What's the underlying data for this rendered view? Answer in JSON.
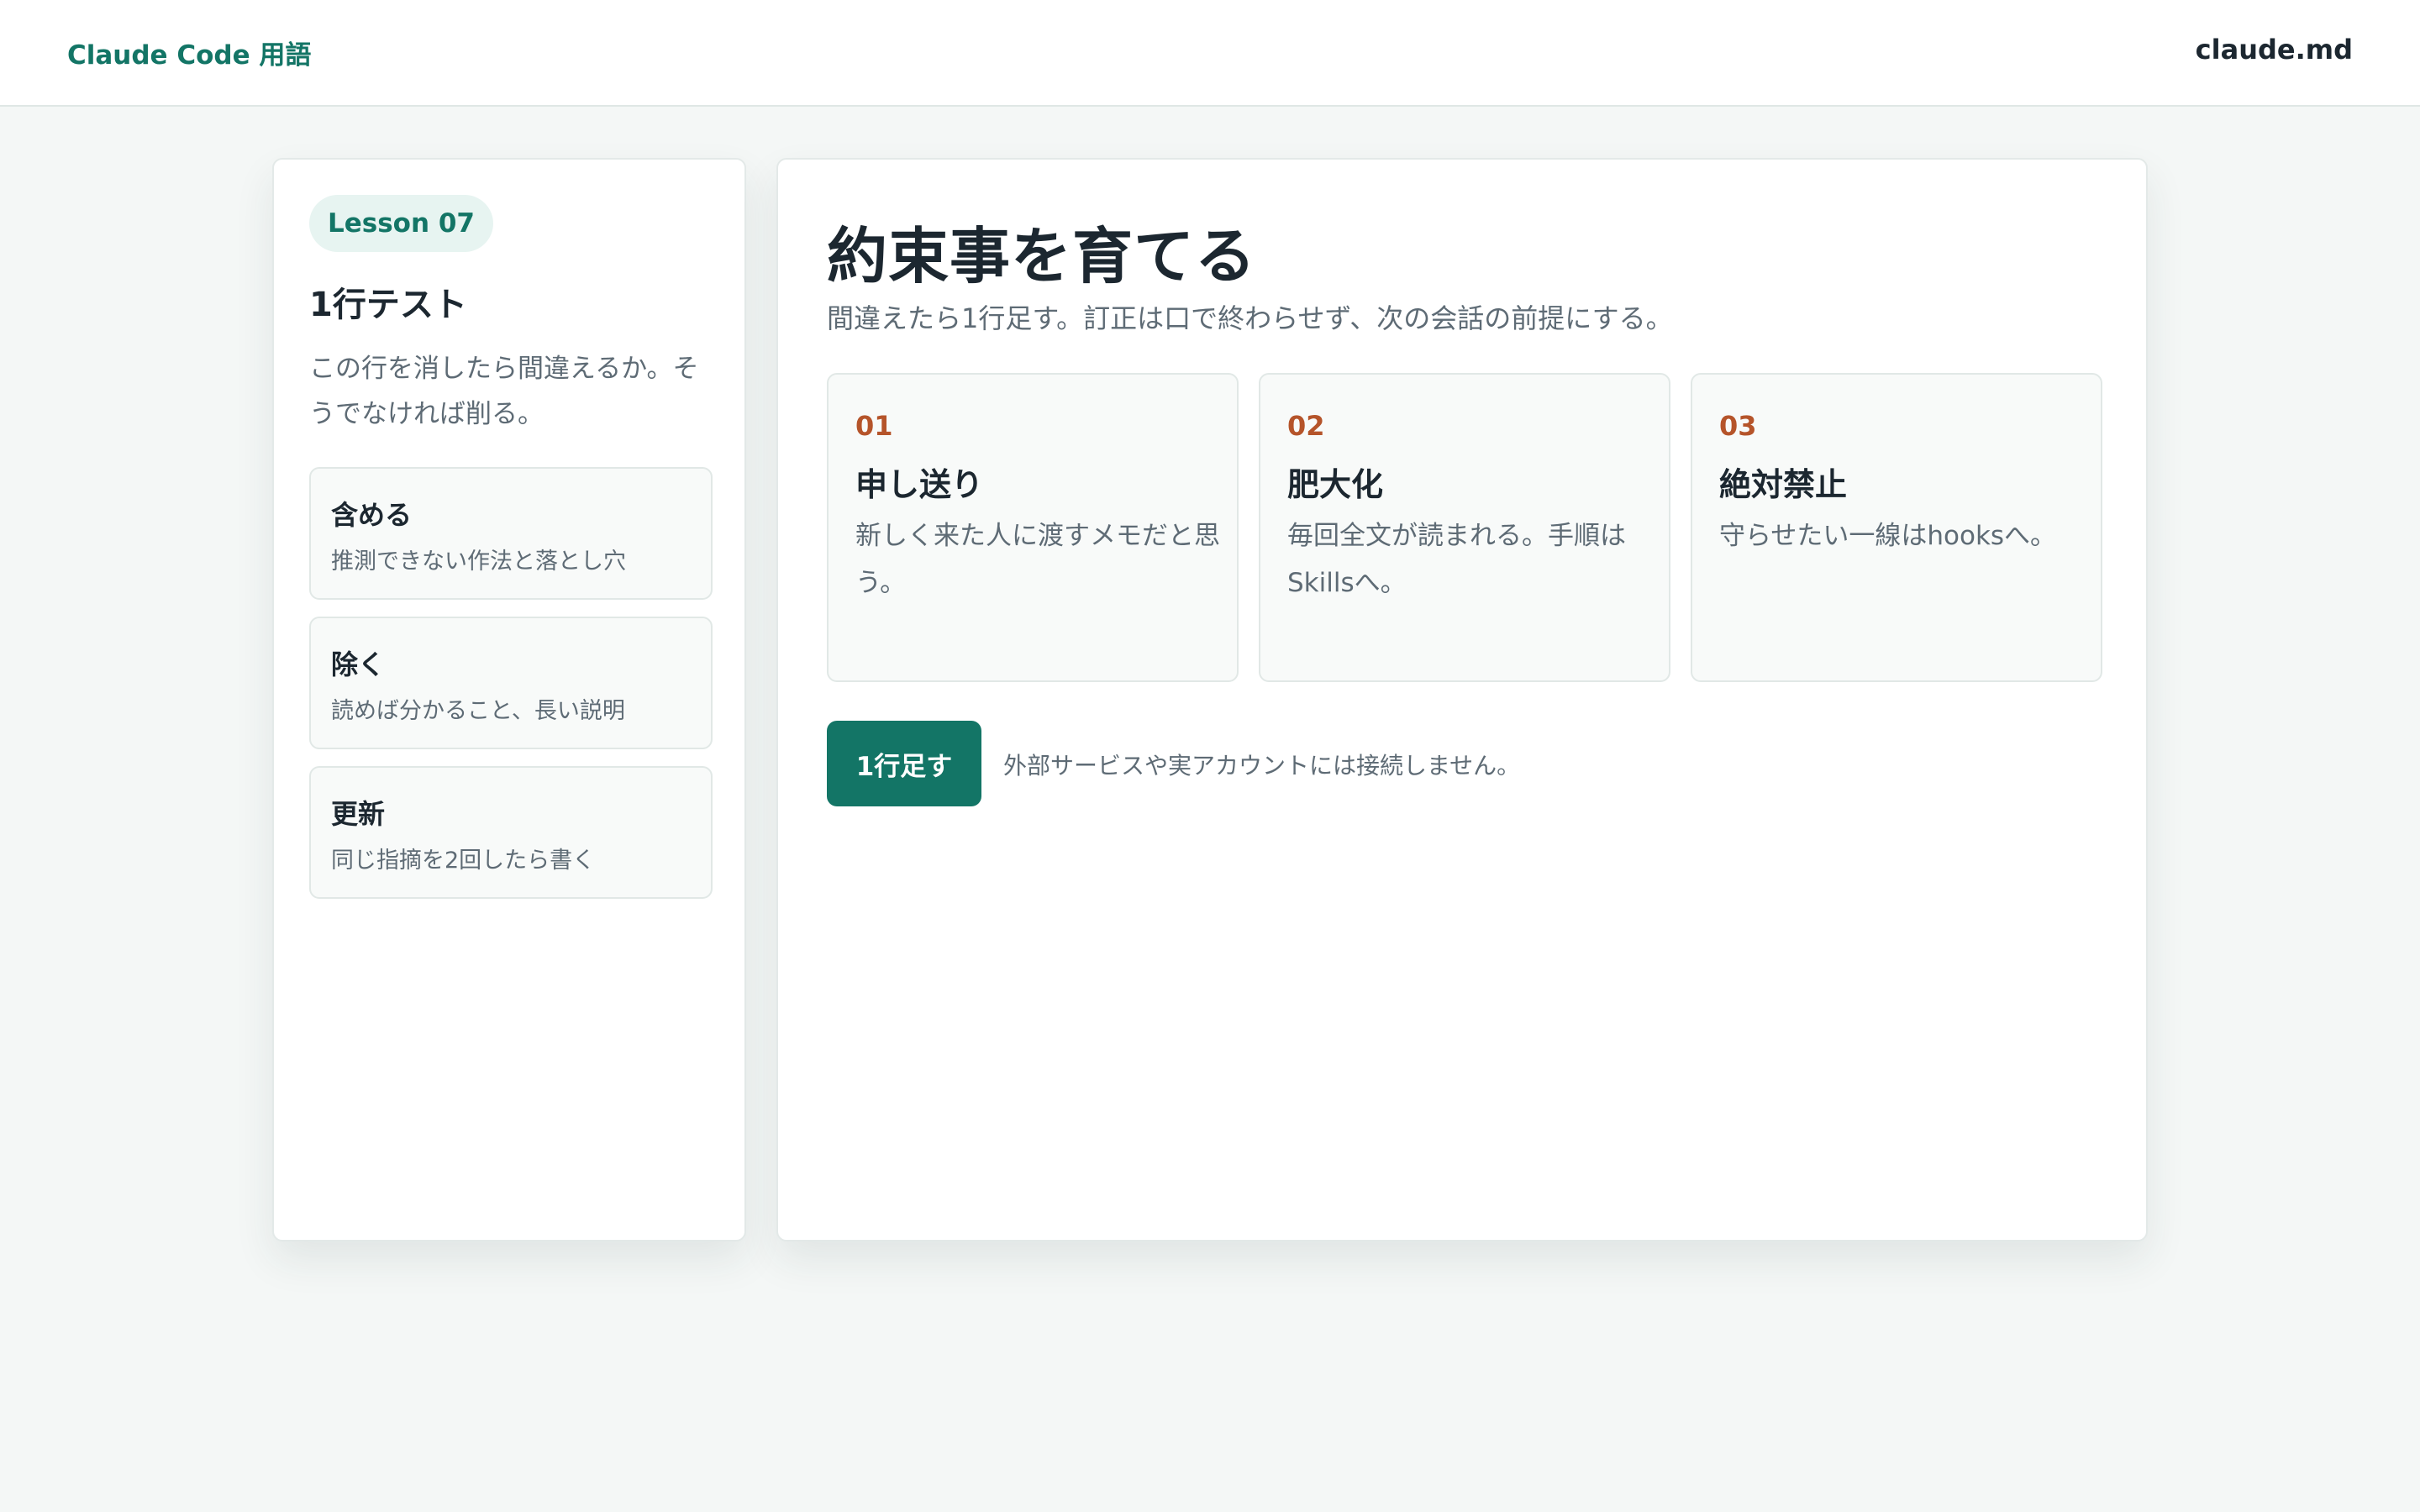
{
  "header": {
    "brand": "Claude Code 用語",
    "right_link": "claude.md"
  },
  "sidebar": {
    "badge": "Lesson 07",
    "title": "1行テスト",
    "description": "この行を消したら間違えるか。そうでなければ削る。",
    "rules": [
      {
        "title": "含める",
        "desc": "推測できない作法と落とし穴"
      },
      {
        "title": "除く",
        "desc": "読めば分かること、長い説明"
      },
      {
        "title": "更新",
        "desc": "同じ指摘を2回したら書く"
      }
    ]
  },
  "main": {
    "title": "約束事を育てる",
    "subtitle": "間違えたら1行足す。訂正は口で終わらせず、次の会話の前提にする。",
    "cards": [
      {
        "num": "01",
        "title": "申し送り",
        "desc": "新しく来た人に渡すメモだと思う。"
      },
      {
        "num": "02",
        "title": "肥大化",
        "desc": "毎回全文が読まれる。手順はSkillsへ。"
      },
      {
        "num": "03",
        "title": "絶対禁止",
        "desc": "守らせたい一線はhooksへ。"
      }
    ],
    "action_button": "1行足す",
    "action_note": "外部サービスや実アカウントには接続しません。"
  },
  "colors": {
    "accent": "#137566",
    "number_accent": "#b5542a",
    "background": "#f4f7f6"
  }
}
